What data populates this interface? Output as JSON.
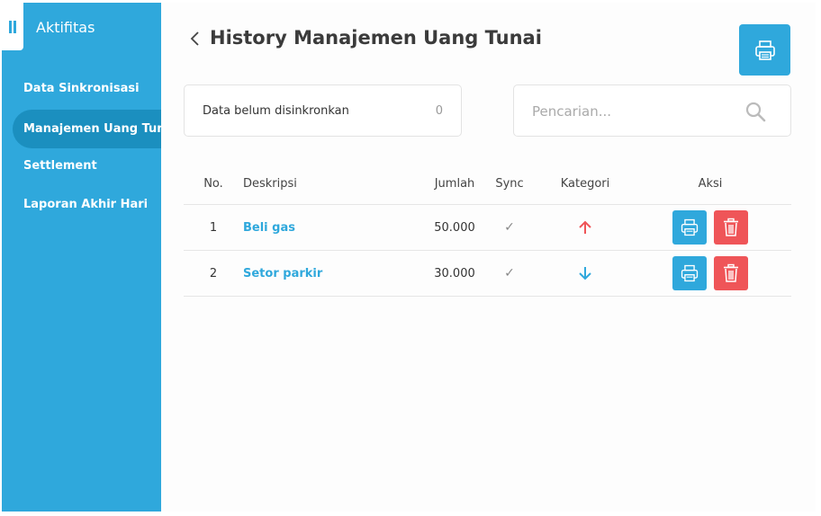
{
  "sidebar": {
    "title": "Aktifitas",
    "items": [
      {
        "label": "Data Sinkronisasi",
        "active": false
      },
      {
        "label": "Manajemen Uang Tunai",
        "active": true
      },
      {
        "label": "Settlement",
        "active": false
      },
      {
        "label": "Laporan Akhir Hari",
        "active": false
      }
    ]
  },
  "header": {
    "back_icon": "chevron-left-icon",
    "title": "History Manajemen Uang Tunai",
    "print_icon": "printer-icon"
  },
  "sync_status": {
    "label": "Data belum disinkronkan",
    "count": "0"
  },
  "search": {
    "placeholder": "Pencarian...",
    "value": "",
    "icon": "search-icon"
  },
  "table": {
    "headers": {
      "no": "No.",
      "desc": "Deskripsi",
      "amount": "Jumlah",
      "sync": "Sync",
      "category": "Kategori",
      "action": "Aksi"
    },
    "rows": [
      {
        "no": "1",
        "desc": "Beli gas",
        "amount": "50.000",
        "sync": "✓",
        "category": "arrow-up-icon"
      },
      {
        "no": "2",
        "desc": "Setor parkir",
        "amount": "30.000",
        "sync": "✓",
        "category": "arrow-down-icon"
      }
    ]
  },
  "colors": {
    "primary": "#2fa8dc",
    "danger": "#ef5558",
    "arrow_up": "#ef5558",
    "arrow_down": "#2fa8dc"
  }
}
